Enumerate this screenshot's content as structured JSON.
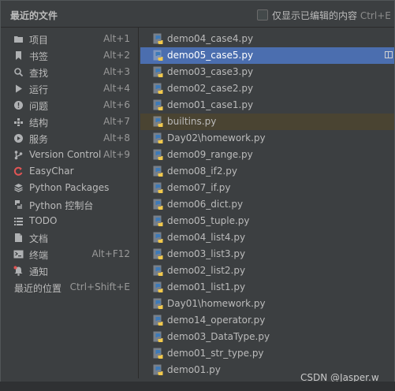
{
  "header": {
    "title": "最近的文件",
    "checkbox_label": "仅显示已编辑的内容",
    "checkbox_shortcut": "Ctrl+E"
  },
  "actions": [
    {
      "label": "项目",
      "shortcut": "Alt+1",
      "icon": "folder-icon"
    },
    {
      "label": "书签",
      "shortcut": "Alt+2",
      "icon": "bookmark-icon"
    },
    {
      "label": "查找",
      "shortcut": "Alt+3",
      "icon": "search-icon"
    },
    {
      "label": "运行",
      "shortcut": "Alt+4",
      "icon": "run-icon"
    },
    {
      "label": "问题",
      "shortcut": "Alt+6",
      "icon": "problems-icon"
    },
    {
      "label": "结构",
      "shortcut": "Alt+7",
      "icon": "structure-icon"
    },
    {
      "label": "服务",
      "shortcut": "Alt+8",
      "icon": "services-icon"
    },
    {
      "label": "Version Control",
      "shortcut": "Alt+9",
      "icon": "vcs-icon"
    },
    {
      "label": "EasyChar",
      "shortcut": "",
      "icon": "easychar-icon"
    },
    {
      "label": "Python Packages",
      "shortcut": "",
      "icon": "packages-icon"
    },
    {
      "label": "Python 控制台",
      "shortcut": "",
      "icon": "python-console-icon"
    },
    {
      "label": "TODO",
      "shortcut": "",
      "icon": "todo-icon"
    },
    {
      "label": "文档",
      "shortcut": "",
      "icon": "docs-icon"
    },
    {
      "label": "终端",
      "shortcut": "Alt+F12",
      "icon": "terminal-icon"
    },
    {
      "label": "通知",
      "shortcut": "",
      "icon": "notification-icon"
    }
  ],
  "recent_locations": {
    "label": "最近的位置",
    "shortcut": "Ctrl+Shift+E"
  },
  "files": [
    {
      "name": "demo04_case4.py",
      "state": ""
    },
    {
      "name": "demo05_case5.py",
      "state": "selected"
    },
    {
      "name": "demo03_case3.py",
      "state": ""
    },
    {
      "name": "demo02_case2.py",
      "state": ""
    },
    {
      "name": "demo01_case1.py",
      "state": ""
    },
    {
      "name": "builtins.py",
      "state": "highlighted"
    },
    {
      "name": "Day02\\homework.py",
      "state": ""
    },
    {
      "name": "demo09_range.py",
      "state": ""
    },
    {
      "name": "demo08_if2.py",
      "state": ""
    },
    {
      "name": "demo07_if.py",
      "state": ""
    },
    {
      "name": "demo06_dict.py",
      "state": ""
    },
    {
      "name": "demo05_tuple.py",
      "state": ""
    },
    {
      "name": "demo04_list4.py",
      "state": ""
    },
    {
      "name": "demo03_list3.py",
      "state": ""
    },
    {
      "name": "demo02_list2.py",
      "state": ""
    },
    {
      "name": "demo01_list1.py",
      "state": ""
    },
    {
      "name": "Day01\\homework.py",
      "state": ""
    },
    {
      "name": "demo14_operator.py",
      "state": ""
    },
    {
      "name": "demo03_DataType.py",
      "state": ""
    },
    {
      "name": "demo01_str_type.py",
      "state": ""
    },
    {
      "name": "demo01.py",
      "state": ""
    }
  ],
  "watermark": "CSDN @Jasper.w",
  "colors": {
    "background": "#3c3f41",
    "selection": "#4b6eaf",
    "highlight": "#4a4432",
    "python_blue": "#3d7ab8",
    "python_yellow": "#f2c94c"
  }
}
